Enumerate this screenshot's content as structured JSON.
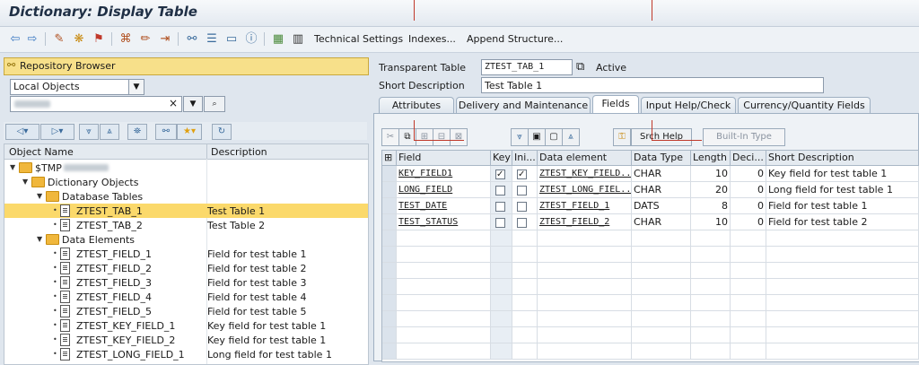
{
  "window": {
    "title": "Dictionary: Display Table"
  },
  "toolbar": {
    "technical_settings": "Technical Settings",
    "indexes": "Indexes...",
    "append_structure": "Append Structure..."
  },
  "left": {
    "repository_browser": "Repository Browser",
    "object_list": "Local Objects",
    "search_clear": "×",
    "tree_headers": {
      "name": "Object Name",
      "description": "Description"
    },
    "tree": [
      {
        "name": "$TMP",
        "desc": "",
        "level": 0,
        "kind": "folder"
      },
      {
        "name": "Dictionary Objects",
        "desc": "",
        "level": 1,
        "kind": "folder"
      },
      {
        "name": "Database Tables",
        "desc": "",
        "level": 2,
        "kind": "folder"
      },
      {
        "name": "ZTEST_TAB_1",
        "desc": "Test Table 1",
        "level": 3,
        "kind": "doc",
        "selected": true
      },
      {
        "name": "ZTEST_TAB_2",
        "desc": "Test Table 2",
        "level": 3,
        "kind": "doc"
      },
      {
        "name": "Data Elements",
        "desc": "",
        "level": 2,
        "kind": "folder"
      },
      {
        "name": "ZTEST_FIELD_1",
        "desc": "Field for test table 1",
        "level": 3,
        "kind": "doc"
      },
      {
        "name": "ZTEST_FIELD_2",
        "desc": "Field for test table 2",
        "level": 3,
        "kind": "doc"
      },
      {
        "name": "ZTEST_FIELD_3",
        "desc": "Field for test table 3",
        "level": 3,
        "kind": "doc"
      },
      {
        "name": "ZTEST_FIELD_4",
        "desc": "Field for test table 4",
        "level": 3,
        "kind": "doc"
      },
      {
        "name": "ZTEST_FIELD_5",
        "desc": "Field for test table 5",
        "level": 3,
        "kind": "doc"
      },
      {
        "name": "ZTEST_KEY_FIELD_1",
        "desc": "Key field for test table 1",
        "level": 3,
        "kind": "doc"
      },
      {
        "name": "ZTEST_KEY_FIELD_2",
        "desc": "Key field for test table 1",
        "level": 3,
        "kind": "doc"
      },
      {
        "name": "ZTEST_LONG_FIELD_1",
        "desc": "Long field for test table 1",
        "level": 3,
        "kind": "doc"
      }
    ]
  },
  "header": {
    "table_type_label": "Transparent Table",
    "table_name": "ZTEST_TAB_1",
    "status": "Active",
    "short_desc_label": "Short Description",
    "short_desc": "Test Table 1"
  },
  "tabs": [
    "Attributes",
    "Delivery and Maintenance",
    "Fields",
    "Input Help/Check",
    "Currency/Quantity Fields"
  ],
  "grid_toolbar": {
    "search_help": "Srch Help",
    "builtin_type": "Built-In Type"
  },
  "grid": {
    "columns": [
      "Field",
      "Key",
      "Ini...",
      "Data element",
      "Data Type",
      "Length",
      "Deci...",
      "Short Description"
    ],
    "rows": [
      {
        "field": "KEY_FIELD1",
        "key": true,
        "initial": true,
        "element": "ZTEST_KEY_FIELD...",
        "type": "CHAR",
        "length": "10",
        "decimals": "0",
        "desc": "Key field for test table 1"
      },
      {
        "field": "LONG_FIELD",
        "key": false,
        "initial": false,
        "element": "ZTEST_LONG_FIEL...",
        "type": "CHAR",
        "length": "20",
        "decimals": "0",
        "desc": "Long field for test table 1"
      },
      {
        "field": "TEST_DATE",
        "key": false,
        "initial": false,
        "element": "ZTEST_FIELD_1",
        "type": "DATS",
        "length": "8",
        "decimals": "0",
        "desc": "Field for test table 1"
      },
      {
        "field": "TEST_STATUS",
        "key": false,
        "initial": false,
        "element": "ZTEST_FIELD_2",
        "type": "CHAR",
        "length": "10",
        "decimals": "0",
        "desc": "Field for test table 2"
      }
    ]
  },
  "colors": {
    "selected_row": "#fbd96b",
    "tree_header_bg": "#f7e08a",
    "accent": "#1f2f45"
  }
}
